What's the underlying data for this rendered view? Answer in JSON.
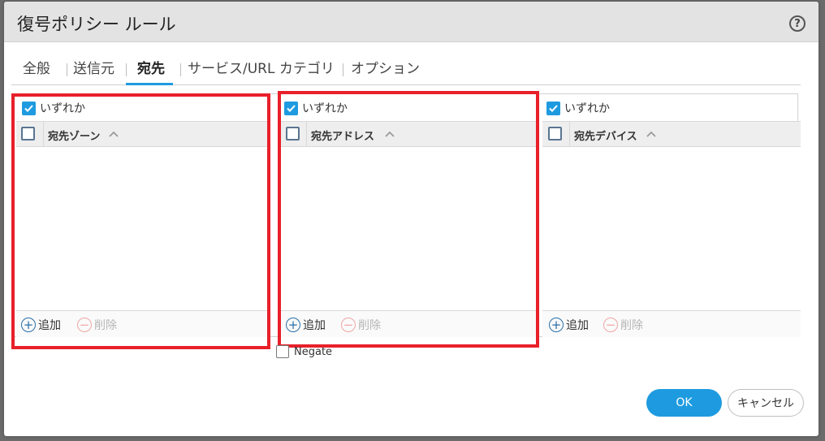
{
  "dialog": {
    "title": "復号ポリシー ルール",
    "help_icon": "?"
  },
  "tabs": [
    {
      "label": "全般",
      "active": false
    },
    {
      "label": "送信元",
      "active": false
    },
    {
      "label": "宛先",
      "active": true
    },
    {
      "label": "サービス/URL カテゴリ",
      "active": false
    },
    {
      "label": "オプション",
      "active": false
    }
  ],
  "panels": [
    {
      "any_label": "いずれか",
      "any_checked": true,
      "column_header": "宛先ゾーン",
      "add_label": "追加",
      "delete_label": "削除",
      "highlighted": true
    },
    {
      "any_label": "いずれか",
      "any_checked": true,
      "column_header": "宛先アドレス",
      "add_label": "追加",
      "delete_label": "削除",
      "highlighted": true
    },
    {
      "any_label": "いずれか",
      "any_checked": true,
      "column_header": "宛先デバイス",
      "add_label": "追加",
      "delete_label": "削除",
      "highlighted": false
    }
  ],
  "negate": {
    "label": "Negate",
    "checked": false
  },
  "buttons": {
    "ok": "OK",
    "cancel": "キャンセル"
  },
  "colors": {
    "accent": "#1e9be0",
    "highlight": "#e8202a",
    "title_bar": "#e3e3e3"
  },
  "icons": {
    "help": "help-icon",
    "sort": "chevron-up-icon",
    "add": "plus-circle-icon",
    "delete": "minus-circle-icon",
    "checkbox": "checkmark-icon"
  }
}
